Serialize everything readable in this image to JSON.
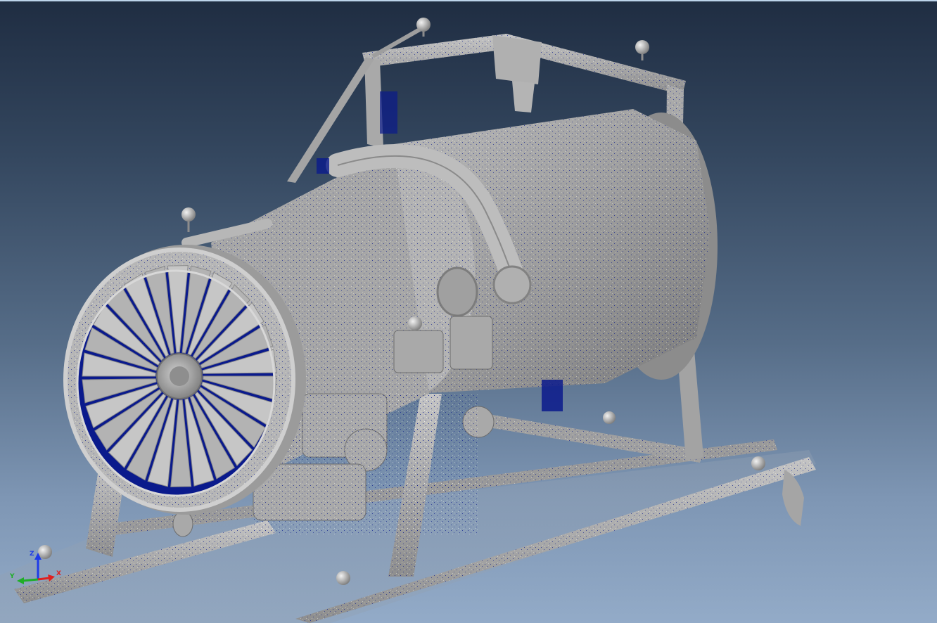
{
  "viewport": {
    "background_top": "#1f2d42",
    "background_bottom": "#93abc8",
    "model_color": "#a7a7a7",
    "backface_color": "#0a1a8c"
  },
  "triad": {
    "x_label": "X",
    "y_label": "Y",
    "z_label": "Z",
    "x_color": "#e0201e",
    "y_color": "#1fae27",
    "z_color": "#1e3be8"
  }
}
